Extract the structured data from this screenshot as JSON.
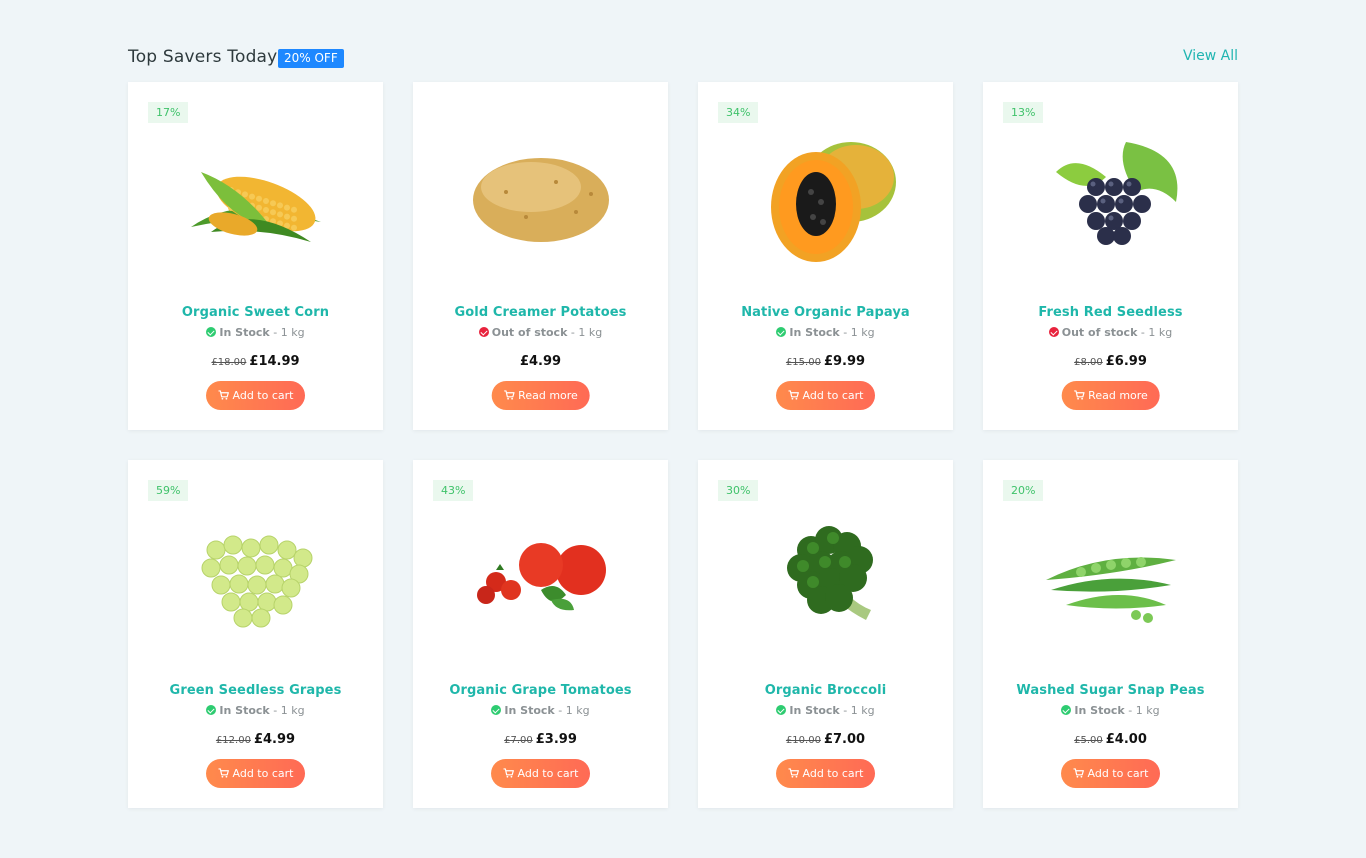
{
  "header": {
    "title": "Top Savers Today",
    "badge": "20% OFF",
    "view_all": "View All"
  },
  "colors": {
    "accent": "#21b5b1",
    "badge": "#1e88ff",
    "in_stock": "#2ecc71",
    "out_of_stock": "#e8233d",
    "button": "#ff7a50"
  },
  "products": [
    {
      "discount": "17%",
      "name": "Organic Sweet Corn",
      "stock": "In Stock",
      "in_stock": true,
      "unit": "- 1 kg",
      "old_price": "£18.00",
      "price": "£14.99",
      "button": "Add to cart",
      "image": "corn"
    },
    {
      "discount": "",
      "name": "Gold Creamer Potatoes",
      "stock": "Out of stock",
      "in_stock": false,
      "unit": "- 1 kg",
      "old_price": "",
      "price": "£4.99",
      "button": "Read more",
      "image": "potato"
    },
    {
      "discount": "34%",
      "name": "Native Organic Papaya",
      "stock": "In Stock",
      "in_stock": true,
      "unit": "- 1 kg",
      "old_price": "£15.00",
      "price": "£9.99",
      "button": "Add to cart",
      "image": "papaya"
    },
    {
      "discount": "13%",
      "name": "Fresh Red Seedless",
      "stock": "Out of stock",
      "in_stock": false,
      "unit": "- 1 kg",
      "old_price": "£8.00",
      "price": "£6.99",
      "button": "Read more",
      "image": "grapes-red"
    },
    {
      "discount": "59%",
      "name": "Green Seedless Grapes",
      "stock": "In Stock",
      "in_stock": true,
      "unit": "- 1 kg",
      "old_price": "£12.00",
      "price": "£4.99",
      "button": "Add to cart",
      "image": "grapes-green"
    },
    {
      "discount": "43%",
      "name": "Organic Grape Tomatoes",
      "stock": "In Stock",
      "in_stock": true,
      "unit": "- 1 kg",
      "old_price": "£7.00",
      "price": "£3.99",
      "button": "Add to cart",
      "image": "tomatoes"
    },
    {
      "discount": "30%",
      "name": "Organic Broccoli",
      "stock": "In Stock",
      "in_stock": true,
      "unit": "- 1 kg",
      "old_price": "£10.00",
      "price": "£7.00",
      "button": "Add to cart",
      "image": "broccoli"
    },
    {
      "discount": "20%",
      "name": "Washed Sugar Snap Peas",
      "stock": "In Stock",
      "in_stock": true,
      "unit": "- 1 kg",
      "old_price": "£5.00",
      "price": "£4.00",
      "button": "Add to cart",
      "image": "peas"
    }
  ]
}
